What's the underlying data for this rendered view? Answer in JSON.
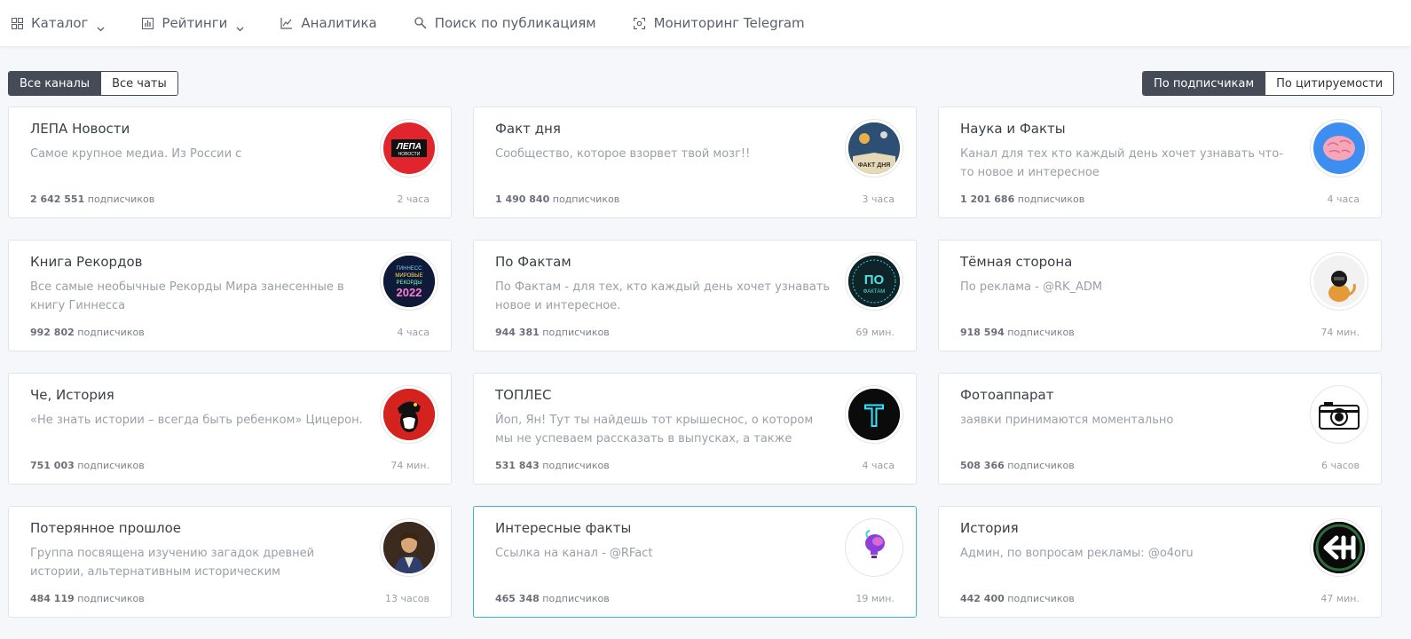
{
  "nav": {
    "catalog": "Каталог",
    "ratings": "Рейтинги",
    "analytics": "Аналитика",
    "search": "Поиск по публикациям",
    "monitoring": "Мониторинг Telegram"
  },
  "filters": {
    "all_channels": "Все каналы",
    "all_chats": "Все чаты"
  },
  "sort": {
    "by_subscribers": "По подписчикам",
    "by_citation": "По цитируемости"
  },
  "subs_word": "подписчиков",
  "cards": [
    {
      "title": "ЛЕПА Новости",
      "desc": "Самое крупное медиа. Из России с",
      "subs": "2 642 551",
      "time": "2 часа",
      "avatar_text": "ЛЕПА НОВОСТИ"
    },
    {
      "title": "Факт дня",
      "desc": "Сообщество, которое взорвет твой мозг!!",
      "subs": "1 490 840",
      "time": "3 часа",
      "avatar_text": "ФАКТ ДНЯ"
    },
    {
      "title": "Наука и Факты",
      "desc": "Канал для тех кто каждый день хочет узнавать что-то новое и интересное",
      "subs": "1 201 686",
      "time": "4 часа",
      "avatar_text": ""
    },
    {
      "title": "Книга Рекордов",
      "desc": "Все самые необычные Рекорды Мира занесенные в книгу Гиннесса",
      "subs": "992 802",
      "time": "4 часа",
      "avatar_text": "ГИННЕСС МИРОВЫЕ РЕКОРДЫ 2022"
    },
    {
      "title": "По Фактам",
      "desc": "По Фактам - для тех, кто каждый день хочет узнавать новое и интересное.",
      "subs": "944 381",
      "time": "69 мин.",
      "avatar_text": "ПО ФАКТАМ"
    },
    {
      "title": "Тёмная сторона",
      "desc": "По реклама - @RK_ADM",
      "subs": "918 594",
      "time": "74 мин.",
      "avatar_text": ""
    },
    {
      "title": "Че, История",
      "desc": "«Не знать истории – всегда быть ребенком» Цицерон.",
      "subs": "751 003",
      "time": "74 мин.",
      "avatar_text": ""
    },
    {
      "title": "ТОПЛЕС",
      "desc": "Йоп, Ян! Тут ты найдешь тот крышеснос, о котором мы не успеваем рассказать в выпусках, а также сочные истори...",
      "subs": "531 843",
      "time": "4 часа",
      "avatar_text": "T"
    },
    {
      "title": "Фотоаппарат",
      "desc": "заявки принимаются моментально",
      "subs": "508 366",
      "time": "6 часов",
      "avatar_text": ""
    },
    {
      "title": "Потерянное прошлое",
      "desc": "Группа посвящена изучению загадок древней истории, альтернативным историческим направлениям и тайнам...",
      "subs": "484 119",
      "time": "13 часов",
      "avatar_text": ""
    },
    {
      "title": "Интересные факты",
      "desc": "Ссылка на канал - @RFact",
      "subs": "465 348",
      "time": "19 мин.",
      "avatar_text": ""
    },
    {
      "title": "История",
      "desc": "Админ, по вопросам рекламы: @o4oru",
      "subs": "442 400",
      "time": "47 мин.",
      "avatar_text": ""
    }
  ],
  "colors": {
    "active_button": "#454c57",
    "highlight_border": "#39b6cf",
    "lepa_red": "#e0262c",
    "science_blue": "#3d8ef0"
  }
}
